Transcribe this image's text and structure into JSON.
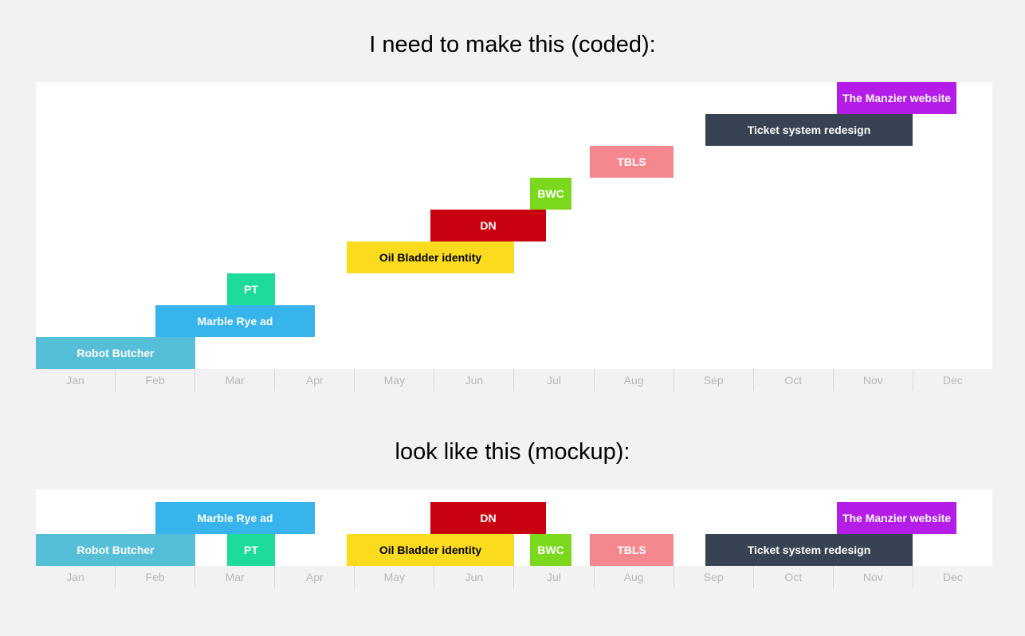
{
  "heading1": "I need to make this (coded):",
  "heading2": "look like this (mockup):",
  "months": [
    "Jan",
    "Feb",
    "Mar",
    "Apr",
    "May",
    "Jun",
    "Jul",
    "Aug",
    "Sep",
    "Oct",
    "Nov",
    "Dec"
  ],
  "monthColWidth": 100,
  "colors": {
    "robot": "#55bfd8",
    "marble": "#36b4eb",
    "pt": "#1ddb99",
    "oil": "#fadb1d",
    "dn": "#c9000f",
    "bwc": "#7cd81d",
    "tbls": "#f5888e",
    "ticket": "#374353",
    "manzier": "#b31de7"
  },
  "chart_data": [
    {
      "type": "bar",
      "layout": "stacked-vertical",
      "title": "coded",
      "bars": [
        {
          "id": "robot",
          "label": "Robot Butcher",
          "start": 0,
          "end": 2,
          "text": "#fff",
          "row": 0
        },
        {
          "id": "marble",
          "label": "Marble Rye ad",
          "start": 1.5,
          "end": 3.5,
          "text": "#fff",
          "row": 1
        },
        {
          "id": "pt",
          "label": "PT",
          "start": 2.4,
          "end": 3,
          "text": "#fff",
          "row": 2
        },
        {
          "id": "oil",
          "label": "Oil Bladder identity",
          "start": 3.9,
          "end": 6,
          "text": "#000",
          "row": 3
        },
        {
          "id": "dn",
          "label": "DN",
          "start": 4.95,
          "end": 6.4,
          "text": "#fff",
          "row": 4
        },
        {
          "id": "bwc",
          "label": "BWC",
          "start": 6.2,
          "end": 6.72,
          "text": "#fff",
          "row": 5
        },
        {
          "id": "tbls",
          "label": "TBLS",
          "start": 6.95,
          "end": 8,
          "text": "#fff",
          "row": 6
        },
        {
          "id": "ticket",
          "label": "Ticket system redesign",
          "start": 8.4,
          "end": 11,
          "text": "#fff",
          "row": 7
        },
        {
          "id": "manzier",
          "label": "The Manzier website",
          "start": 10.05,
          "end": 11.55,
          "text": "#fff",
          "row": 8
        }
      ]
    },
    {
      "type": "bar",
      "layout": "compact-2-row",
      "title": "mockup",
      "bars": [
        {
          "id": "robot",
          "label": "Robot Butcher",
          "start": 0,
          "end": 2,
          "text": "#fff",
          "row": 0
        },
        {
          "id": "marble",
          "label": "Marble Rye ad",
          "start": 1.5,
          "end": 3.5,
          "text": "#fff",
          "row": 1
        },
        {
          "id": "pt",
          "label": "PT",
          "start": 2.4,
          "end": 3,
          "text": "#fff",
          "row": 0
        },
        {
          "id": "oil",
          "label": "Oil Bladder identity",
          "start": 3.9,
          "end": 6,
          "text": "#000",
          "row": 0
        },
        {
          "id": "dn",
          "label": "DN",
          "start": 4.95,
          "end": 6.4,
          "text": "#fff",
          "row": 1
        },
        {
          "id": "bwc",
          "label": "BWC",
          "start": 6.2,
          "end": 6.72,
          "text": "#fff",
          "row": 0
        },
        {
          "id": "tbls",
          "label": "TBLS",
          "start": 6.95,
          "end": 8,
          "text": "#fff",
          "row": 0
        },
        {
          "id": "ticket",
          "label": "Ticket system redesign",
          "start": 8.4,
          "end": 11,
          "text": "#fff",
          "row": 0
        },
        {
          "id": "manzier",
          "label": "The Manzier website",
          "start": 10.05,
          "end": 11.55,
          "text": "#fff",
          "row": 1
        }
      ]
    }
  ]
}
